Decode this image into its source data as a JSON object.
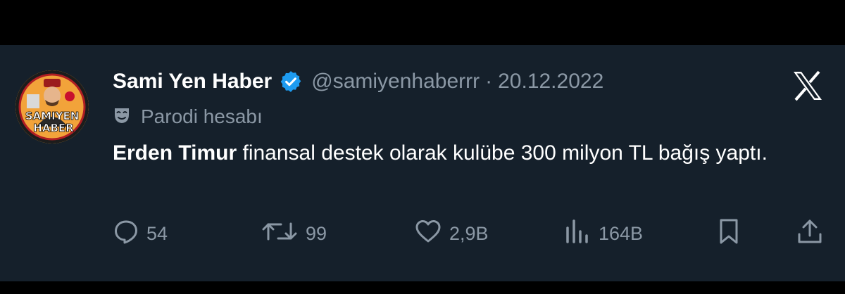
{
  "tweet": {
    "display_name": "Sami Yen Haber",
    "handle": "@samiyenhaberrr",
    "separator": "·",
    "date": "20.12.2022",
    "parody_label": "Parodi hesabı",
    "text_bold": "Erden Timur",
    "text_rest": " finansal destek olarak kulübe 300 milyon TL bağış yaptı.",
    "avatar_lines": [
      "SAMIYEN",
      "HABER"
    ]
  },
  "actions": {
    "reply_count": "54",
    "retweet_count": "99",
    "like_count": "2,9B",
    "views_count": "164B"
  },
  "icons": {
    "verified": "verified-badge-icon",
    "platform": "x-logo-icon",
    "parody": "theater-mask-icon",
    "reply": "reply-icon",
    "retweet": "retweet-icon",
    "like": "heart-icon",
    "views": "views-icon",
    "bookmark": "bookmark-icon",
    "share": "share-icon"
  },
  "colors": {
    "background": "#15202b",
    "text_primary": "#ffffff",
    "text_secondary": "#8b98a5",
    "verified_blue": "#1d9bf0"
  }
}
